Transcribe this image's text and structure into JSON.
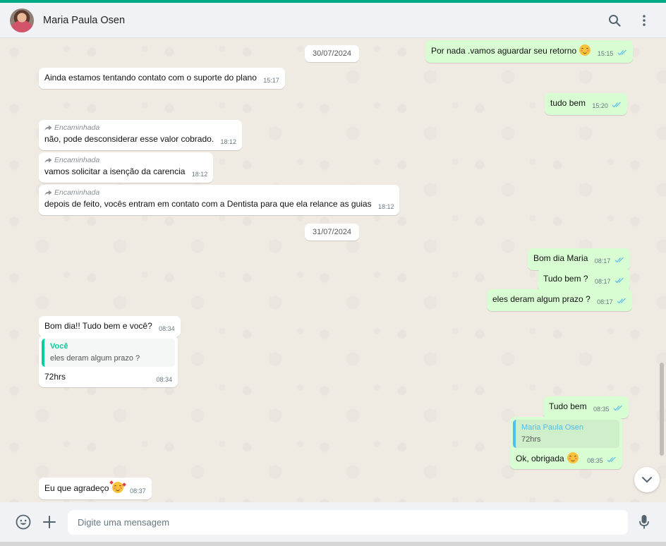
{
  "colors": {
    "accent": "#00a884",
    "incoming": "#ffffff",
    "outgoing": "#d9fdd3",
    "read_ticks": "#53bdeb"
  },
  "header": {
    "contact_name": "Maria Paula Osen",
    "search_icon": "search-icon",
    "menu_icon": "more-vertical-icon"
  },
  "dates": {
    "d1": "30/07/2024",
    "d2": "31/07/2024"
  },
  "messages": {
    "m1": {
      "text": "Por nada .vamos aguardar seu retorno",
      "time": "15:15",
      "emoji": "smiling-face-emoji"
    },
    "m2": {
      "text": "Ainda estamos tentando contato com o suporte do plano",
      "time": "15:17"
    },
    "m3": {
      "text": "tudo bem",
      "time": "15:20"
    },
    "m4": {
      "forwarded": "Encaminhada",
      "text": "não, pode desconsiderar esse valor cobrado.",
      "time": "18:12"
    },
    "m5": {
      "forwarded": "Encaminhada",
      "text": "vamos solicitar a isenção da carencia",
      "time": "18:12"
    },
    "m6": {
      "forwarded": "Encaminhada",
      "text": "depois de feito, vocês entram em contato com a Dentista para que ela relance as guias",
      "time": "18:12"
    },
    "m7": {
      "text": "Bom dia Maria",
      "time": "08:17"
    },
    "m8": {
      "text": "Tudo bem ?",
      "time": "08:17"
    },
    "m9": {
      "text": "eles deram algum prazo ?",
      "time": "08:17"
    },
    "m10": {
      "text": "Bom dia!! Tudo bem e você?",
      "time": "08:34"
    },
    "m11": {
      "quote_author": "Você",
      "quote_text": "eles deram algum prazo ?",
      "text": "72hrs",
      "time": "08:34"
    },
    "m12": {
      "text": "Tudo bem",
      "time": "08:35"
    },
    "m13": {
      "quote_author": "Maria Paula Osen",
      "quote_text": "72hrs",
      "text": "Ok, obrigada",
      "time": "08:35",
      "emoji": "smiling-face-emoji"
    },
    "m14": {
      "text": "Eu que agradeço",
      "time": "08:37",
      "emoji": "smiling-face-with-hearts-emoji"
    }
  },
  "composer": {
    "placeholder": "Digite uma mensagem"
  },
  "footer_icons": [
    "emoji-icon",
    "plus-icon",
    "microphone-icon"
  ]
}
